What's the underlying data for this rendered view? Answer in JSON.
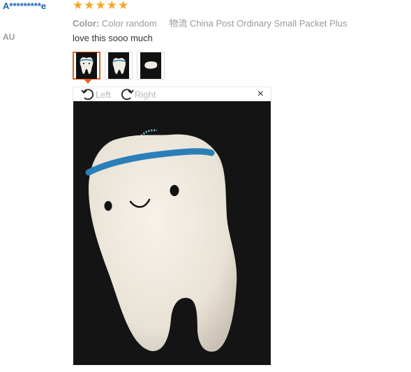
{
  "review": {
    "reviewer": "A*********e",
    "country": "AU",
    "rating": 5,
    "stars": [
      "★",
      "★",
      "★",
      "★",
      "★"
    ],
    "color_label": "Color:",
    "color_value": "Color random",
    "shipping_label": "物流",
    "shipping_value": "China Post Ordinary Small Packet Plus",
    "text": "love this sooo much"
  },
  "viewer": {
    "rotate_left_label": "Left",
    "rotate_right_label": "Right",
    "close_symbol": "×"
  },
  "colors": {
    "reviewer": "#1b63b5",
    "star": "#f5a623",
    "active_thumb_border": "#e8621a",
    "photo_background": "#141414"
  }
}
